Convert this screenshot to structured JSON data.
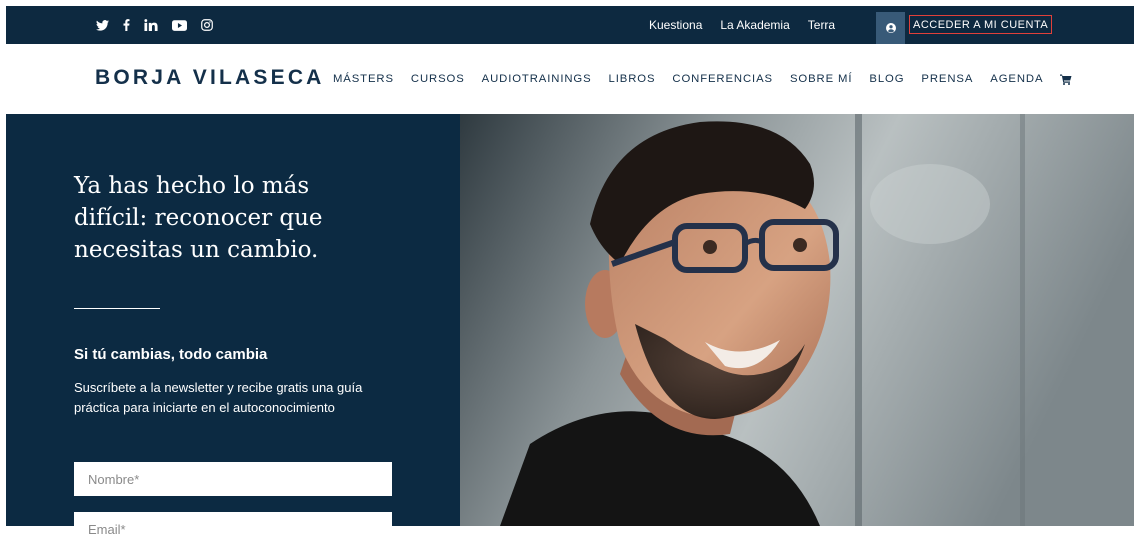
{
  "topbar": {
    "social": [
      "twitter-icon",
      "facebook-icon",
      "linkedin-icon",
      "youtube-icon",
      "instagram-icon"
    ],
    "links": [
      "Kuestiona",
      "La Akademia",
      "Terra"
    ],
    "account_label": "ACCEDER A MI CUENTA"
  },
  "header": {
    "logo": "BORJA VILASECA",
    "nav": [
      "MÁSTERS",
      "CURSOS",
      "AUDIOTRAININGS",
      "LIBROS",
      "CONFERENCIAS",
      "SOBRE MÍ",
      "BLOG",
      "PRENSA",
      "AGENDA"
    ]
  },
  "hero": {
    "headline": "Ya has hecho lo más difícil: reconocer que necesitas un cambio.",
    "subheading": "Si tú cambias, todo cambia",
    "description": "Suscríbete a la newsletter y recibe gratis una guía práctica para iniciarte en el autoconocimiento",
    "name_placeholder": "Nombre*",
    "email_placeholder": "Email*"
  },
  "colors": {
    "navy_dark": "#0c2a42",
    "topbar": "#0d2940",
    "accent_border": "#e0403a",
    "logo_text": "#14304a"
  }
}
